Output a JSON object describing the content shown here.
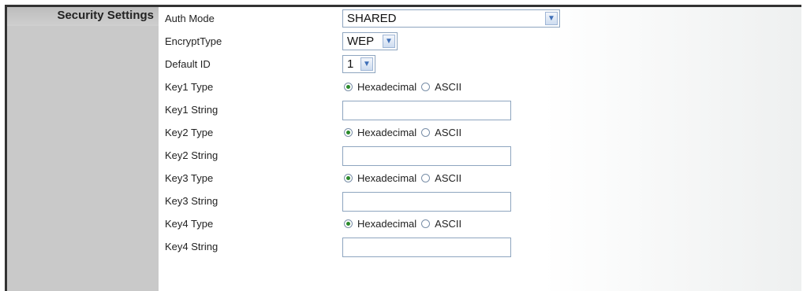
{
  "section": {
    "title": "Security Settings"
  },
  "fields": {
    "auth_mode": {
      "label": "Auth Mode",
      "value": "SHARED"
    },
    "encrypt_type": {
      "label": "EncryptType",
      "value": "WEP"
    },
    "default_id": {
      "label": "Default ID",
      "value": "1"
    },
    "key1_type": {
      "label": "Key1 Type",
      "option1": "Hexadecimal",
      "option2": "ASCII",
      "selected": "Hexadecimal"
    },
    "key1_string": {
      "label": "Key1 String",
      "value": ""
    },
    "key2_type": {
      "label": "Key2 Type",
      "option1": "Hexadecimal",
      "option2": "ASCII",
      "selected": "Hexadecimal"
    },
    "key2_string": {
      "label": "Key2 String",
      "value": ""
    },
    "key3_type": {
      "label": "Key3 Type",
      "option1": "Hexadecimal",
      "option2": "ASCII",
      "selected": "Hexadecimal"
    },
    "key3_string": {
      "label": "Key3 String",
      "value": ""
    },
    "key4_type": {
      "label": "Key4 Type",
      "option1": "Hexadecimal",
      "option2": "ASCII",
      "selected": "Hexadecimal"
    },
    "key4_string": {
      "label": "Key4 String",
      "value": ""
    }
  },
  "icons": {
    "dropdown": "chevron-down-icon",
    "radio": "radio-icon"
  },
  "colors": {
    "sidebar": "#c9c9c9",
    "radio_selected": "#2b8a2b",
    "dropdown_arrow": "#3f6fb8"
  }
}
